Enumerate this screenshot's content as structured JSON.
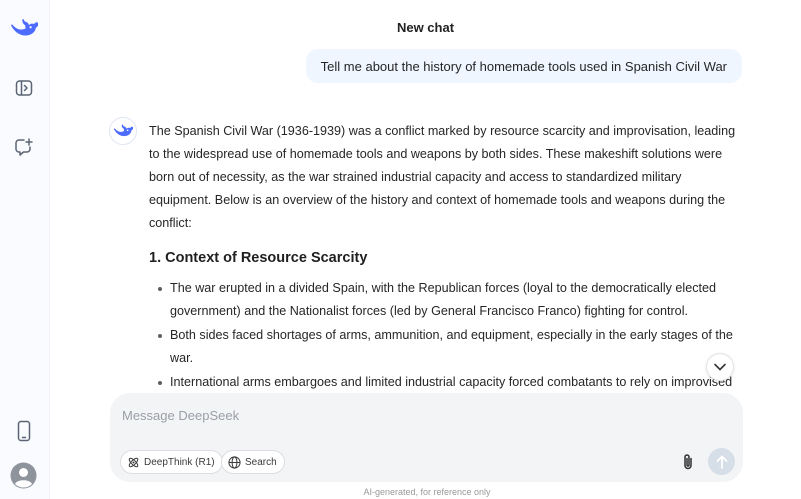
{
  "header": {
    "title": "New chat"
  },
  "sidebar": {
    "logo_icon": "deepseek-whale-icon",
    "items": [
      {
        "name": "toggle-sidebar",
        "icon": "sidebar-toggle-icon"
      },
      {
        "name": "new-chat",
        "icon": "new-chat-icon"
      }
    ],
    "bottom": [
      {
        "name": "mobile-app",
        "icon": "phone-icon"
      },
      {
        "name": "profile",
        "icon": "user-avatar-icon"
      }
    ]
  },
  "conversation": {
    "user_message": "Tell me about the history of homemade tools used in Spanish Civil War",
    "assistant": {
      "intro": "The Spanish Civil War (1936-1939) was a conflict marked by resource scarcity and improvisation, leading to the widespread use of homemade tools and weapons by both sides. These makeshift solutions were born out of necessity, as the war strained industrial capacity and access to standardized military equipment. Below is an overview of the history and context of homemade tools and weapons during the conflict:",
      "section_heading": "1. Context of Resource Scarcity",
      "bullets": [
        "The war erupted in a divided Spain, with the Republican forces (loyal to the democratically elected government) and the Nationalist forces (led by General Francisco Franco) fighting for control.",
        "Both sides faced shortages of arms, ammunition, and equipment, especially in the early stages of the war.",
        "International arms embargoes and limited industrial capacity forced combatants to rely on improvised solutions."
      ]
    }
  },
  "composer": {
    "placeholder": "Message DeepSeek",
    "value": "",
    "deepthink_label": "DeepThink (R1)",
    "search_label": "Search"
  },
  "footer": {
    "note": "AI-generated, for reference only"
  },
  "colors": {
    "accent": "#4d6bfe",
    "user_bubble": "#eff6ff",
    "composer_bg": "#f3f4f6",
    "send_disabled": "#d6dee8"
  }
}
